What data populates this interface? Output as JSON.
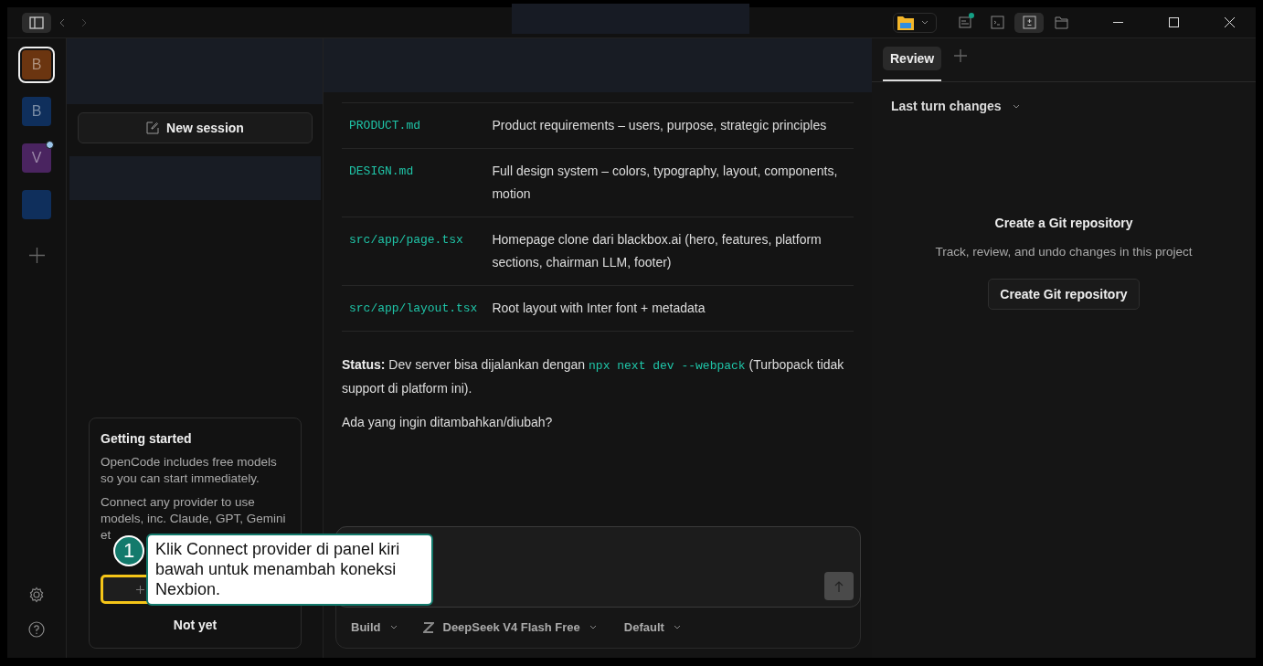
{
  "titlebar": {
    "sidebar_toggle": {
      "selected": true
    },
    "toolbar_buttons": [
      {
        "kind": "changes",
        "selected": false,
        "dot": true
      },
      {
        "kind": "terminal",
        "selected": false,
        "dot": false
      },
      {
        "kind": "review",
        "selected": true,
        "dot": false
      },
      {
        "kind": "files",
        "selected": false,
        "dot": false
      }
    ]
  },
  "projects": [
    {
      "initial": "B",
      "color": "#6b3510",
      "selected": true,
      "dot": false
    },
    {
      "initial": "B",
      "color": "#0f2f5c",
      "selected": false,
      "dot": false
    },
    {
      "initial": "V",
      "color": "#4a2460",
      "selected": false,
      "dot": true
    },
    {
      "color": "#0f2f5c",
      "selected": false,
      "dot": false
    }
  ],
  "sidebar": {
    "new_session": "New session",
    "getting_started": {
      "title": "Getting started",
      "paragraphs": [
        "OpenCode includes free models so you can start immediately.",
        "Connect any provider to use models, inc. Claude, GPT, Gemini et"
      ],
      "dismiss": "Not yet"
    }
  },
  "callout": {
    "number": "1",
    "text": "Klik Connect provider di panel kiri bawah untuk menambah koneksi Nexbion."
  },
  "message": {
    "files": [
      {
        "file": "PRODUCT.md",
        "description": "Product requirements – users, purpose, strategic principles"
      },
      {
        "file": "DESIGN.md",
        "description": "Full design system – colors, typography, layout, components, motion"
      },
      {
        "file": "src/app/page.tsx",
        "description": "Homepage clone dari blackbox.ai (hero, features, platform sections, chairman LLM, footer)"
      },
      {
        "file": "src/app/layout.tsx",
        "description": "Root layout with Inter font + metadata"
      }
    ],
    "status": {
      "text": "**Status:** Dev server bisa dijalankan dengan",
      "code": "npx next dev --webpack",
      "after": "(Turbopack tidak support di platform ini)."
    },
    "question": "Ada yang ingin ditambahkan/diubah?"
  },
  "composer": {
    "mode": "Build",
    "model": "DeepSeek V4 Flash Free",
    "variant": "Default"
  },
  "review": {
    "tabs": [
      {
        "label": "Review",
        "selected": true
      }
    ],
    "changes_filter": "Last turn changes",
    "empty_title": "Create a Git repository",
    "empty_text": "Track, review, and undo changes in this project",
    "create_button": "Create Git repository"
  }
}
